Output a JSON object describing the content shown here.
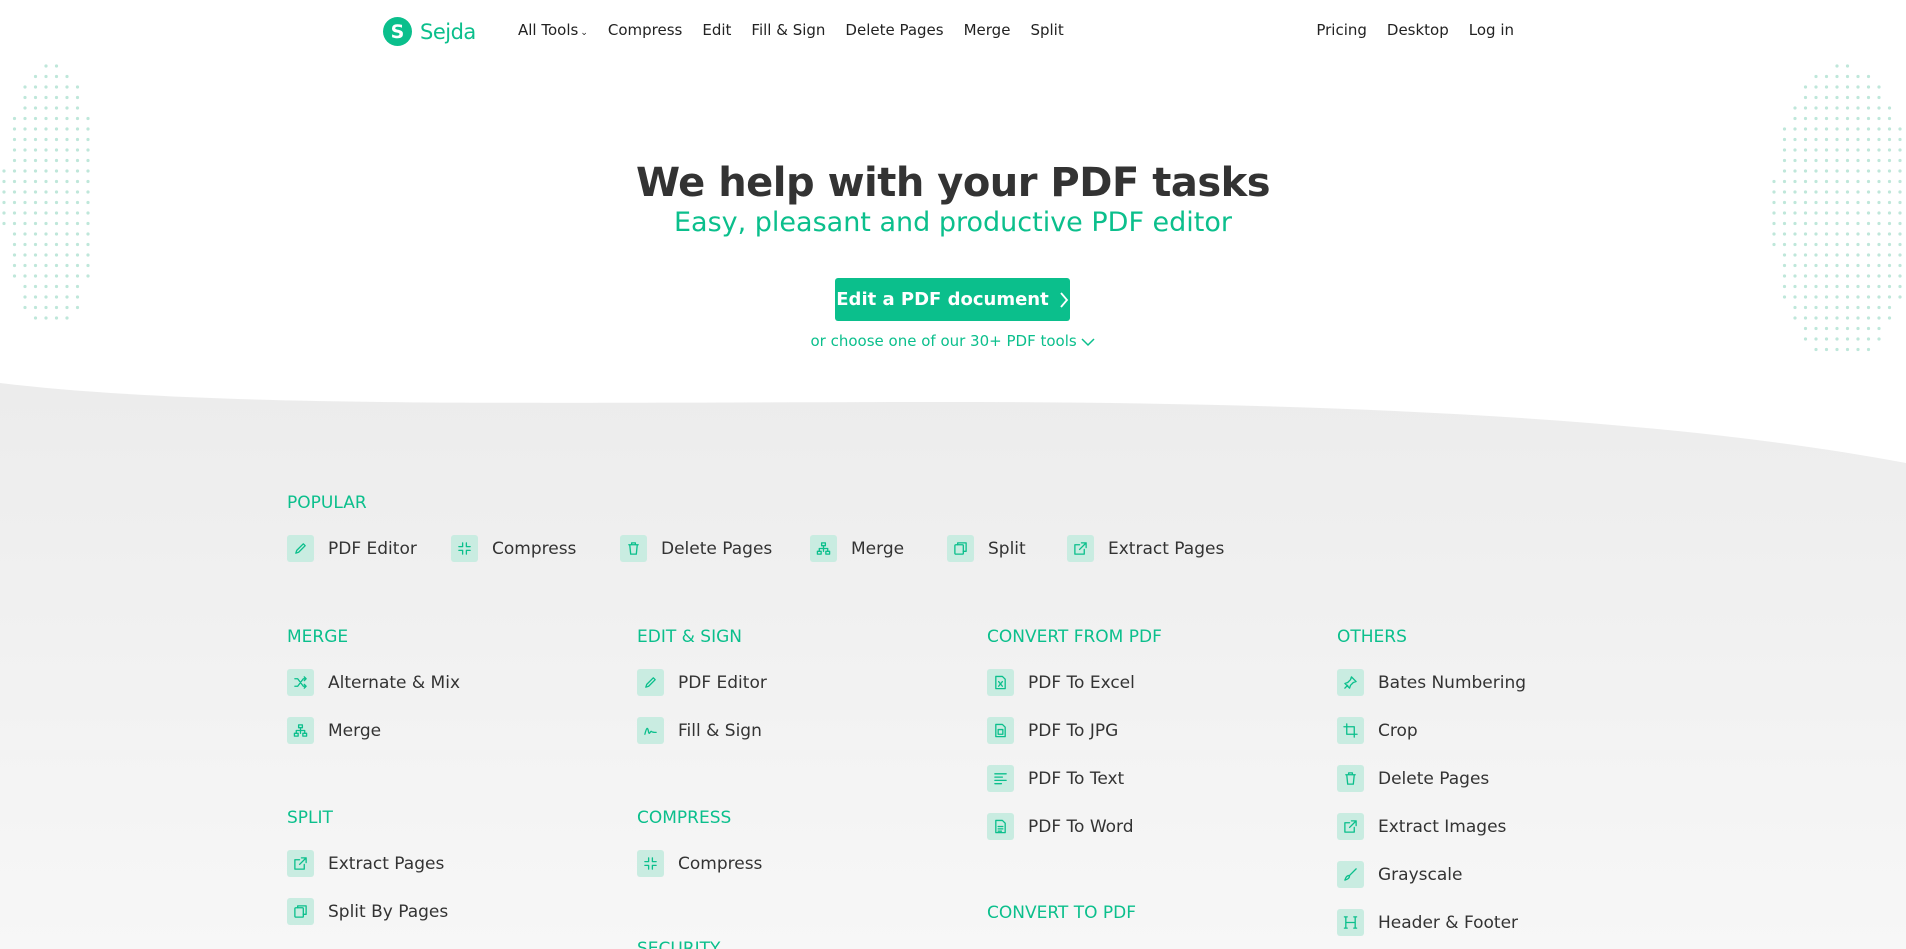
{
  "brand": {
    "name": "Sejda",
    "logo_letter": "S",
    "accent": "#0bbf8c"
  },
  "nav": {
    "left": [
      {
        "label": "All Tools",
        "has_dropdown": true
      },
      {
        "label": "Compress"
      },
      {
        "label": "Edit"
      },
      {
        "label": "Fill & Sign"
      },
      {
        "label": "Delete Pages"
      },
      {
        "label": "Merge"
      },
      {
        "label": "Split"
      }
    ],
    "right": [
      {
        "label": "Pricing"
      },
      {
        "label": "Desktop"
      },
      {
        "label": "Log in"
      }
    ]
  },
  "hero": {
    "title": "We help with your PDF tasks",
    "subtitle": "Easy, pleasant and productive PDF editor",
    "cta_label": "Edit a PDF document",
    "more_label": "or choose one of our 30+ PDF tools"
  },
  "popular": {
    "title": "POPULAR",
    "items": [
      {
        "label": "PDF Editor",
        "icon": "pencil-icon"
      },
      {
        "label": "Compress",
        "icon": "compress-icon"
      },
      {
        "label": "Delete Pages",
        "icon": "trash-icon"
      },
      {
        "label": "Merge",
        "icon": "merge-icon"
      },
      {
        "label": "Split",
        "icon": "split-icon"
      },
      {
        "label": "Extract Pages",
        "icon": "extract-icon"
      }
    ]
  },
  "categories": {
    "merge": {
      "title": "MERGE",
      "items": [
        {
          "label": "Alternate & Mix",
          "icon": "shuffle-icon"
        },
        {
          "label": "Merge",
          "icon": "merge-icon"
        }
      ]
    },
    "edit_sign": {
      "title": "EDIT & SIGN",
      "items": [
        {
          "label": "PDF Editor",
          "icon": "pencil-icon"
        },
        {
          "label": "Fill & Sign",
          "icon": "signature-icon"
        }
      ]
    },
    "convert_from": {
      "title": "CONVERT FROM PDF",
      "items": [
        {
          "label": "PDF To Excel",
          "icon": "excel-icon"
        },
        {
          "label": "PDF To JPG",
          "icon": "image-file-icon"
        },
        {
          "label": "PDF To Text",
          "icon": "text-lines-icon"
        },
        {
          "label": "PDF To Word",
          "icon": "word-icon"
        }
      ]
    },
    "others": {
      "title": "OTHERS",
      "items": [
        {
          "label": "Bates Numbering",
          "icon": "stamp-icon"
        },
        {
          "label": "Crop",
          "icon": "crop-icon"
        },
        {
          "label": "Delete Pages",
          "icon": "trash-icon"
        },
        {
          "label": "Extract Images",
          "icon": "extract-icon"
        },
        {
          "label": "Grayscale",
          "icon": "brush-icon"
        },
        {
          "label": "Header & Footer",
          "icon": "header-icon"
        }
      ]
    },
    "split": {
      "title": "SPLIT",
      "items": [
        {
          "label": "Extract Pages",
          "icon": "extract-icon"
        },
        {
          "label": "Split By Pages",
          "icon": "split-icon"
        }
      ]
    },
    "compress": {
      "title": "COMPRESS",
      "items": [
        {
          "label": "Compress",
          "icon": "compress-icon"
        }
      ]
    },
    "security": {
      "title": "SECURITY"
    },
    "convert_to": {
      "title": "CONVERT TO PDF"
    }
  }
}
